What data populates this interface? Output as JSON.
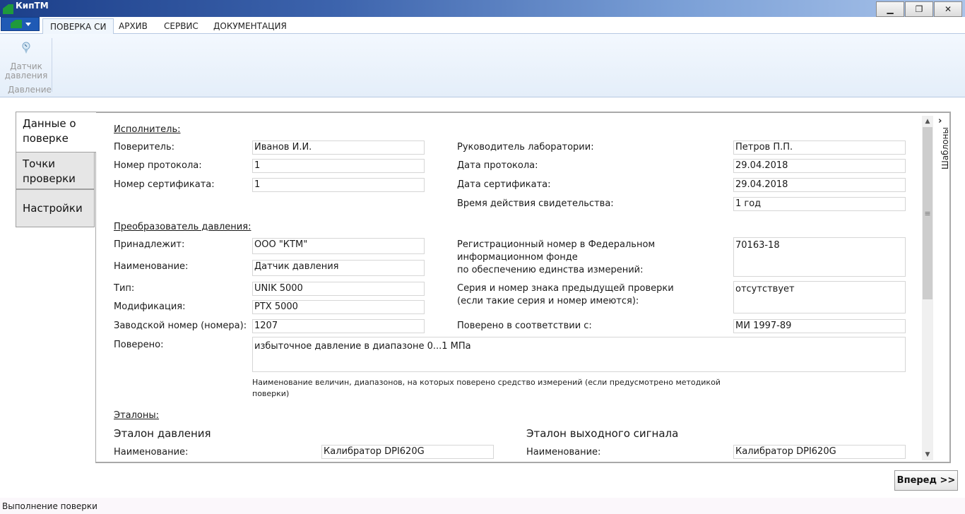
{
  "window": {
    "title": "КипТМ",
    "minimize_glyph": "▁",
    "maximize_glyph": "❐",
    "close_glyph": "✕"
  },
  "ribbon": {
    "tabs": [
      "ПОВЕРКА СИ",
      "АРХИВ",
      "СЕРВИС",
      "ДОКУМЕНТАЦИЯ"
    ],
    "buttons": [
      {
        "label": "Датчик давления",
        "icon": "pressure-sensor-icon"
      }
    ],
    "group_label": "Давление"
  },
  "side_tabs": [
    "Данные о поверке",
    "Точки проверки",
    "Настройки"
  ],
  "templates_label": "Шаблоны",
  "scroll_arrows": {
    "up": "▲",
    "down": "▼",
    "grip": "≡",
    "panel_chevron": "›"
  },
  "form": {
    "executor": {
      "header": "Исполнитель:",
      "verifier_label": "Поверитель:",
      "verifier_value": "Иванов И.И.",
      "protocol_no_label": "Номер протокола:",
      "protocol_no_value": "1",
      "certificate_no_label": "Номер сертификата:",
      "certificate_no_value": "1",
      "lab_head_label": "Руководитель лаборатории:",
      "lab_head_value": "Петров П.П.",
      "protocol_date_label": "Дата протокола:",
      "protocol_date_value": "29.04.2018",
      "certificate_date_label": "Дата сертификата:",
      "certificate_date_value": "29.04.2018",
      "validity_label": "Время действия свидетельства:",
      "validity_value": "1 год"
    },
    "transducer": {
      "header": "Преобразователь давления:",
      "owner_label": "Принадлежит:",
      "owner_value": "ООО \"КТМ\"",
      "name_label": "Наименование:",
      "name_value": "Датчик давления",
      "type_label": "Тип:",
      "type_value": "UNIK 5000",
      "modification_label": "Модификация:",
      "modification_value": "PTX 5000",
      "serial_label": "Заводской номер (номера):",
      "serial_value": "1207",
      "reg_number_label_1": "Регистрационный номер в Федеральном",
      "reg_number_label_2": "информационном фонде",
      "reg_number_label_3": "по обеспечению единства измерений:",
      "reg_number_value": "70163-18",
      "prev_mark_label_1": "Серия и номер знака предыдущей проверки",
      "prev_mark_label_2": "(если такие серия и номер имеются):",
      "prev_mark_value": "отсутствует",
      "verified_by_label": "Поверено в соответствии с:",
      "verified_by_value": "МИ 1997-89",
      "verified_label": "Поверено:",
      "verified_value": "избыточное давление в диапазоне 0...1 МПа",
      "verified_hint_1": "Наименование величин, диапазонов, на которых поверено средство измерений (если предусмотрено методикой",
      "verified_hint_2": "поверки)"
    },
    "standards": {
      "header": "Эталоны:",
      "pressure_title": "Эталон давления",
      "pressure_name_label": "Наименование:",
      "pressure_name_value": "Калибратор DPI620G",
      "output_title": "Эталон выходного сигнала",
      "output_name_label": "Наименование:",
      "output_name_value": "Калибратор DPI620G"
    }
  },
  "next_button": "Вперед >>",
  "status": "Выполнение поверки",
  "colors": {
    "titlebar_start": "#1c3f8a",
    "titlebar_end": "#aac4ea",
    "app_menu": "#1f5ab5",
    "logo_green": "#1f9a3c"
  }
}
